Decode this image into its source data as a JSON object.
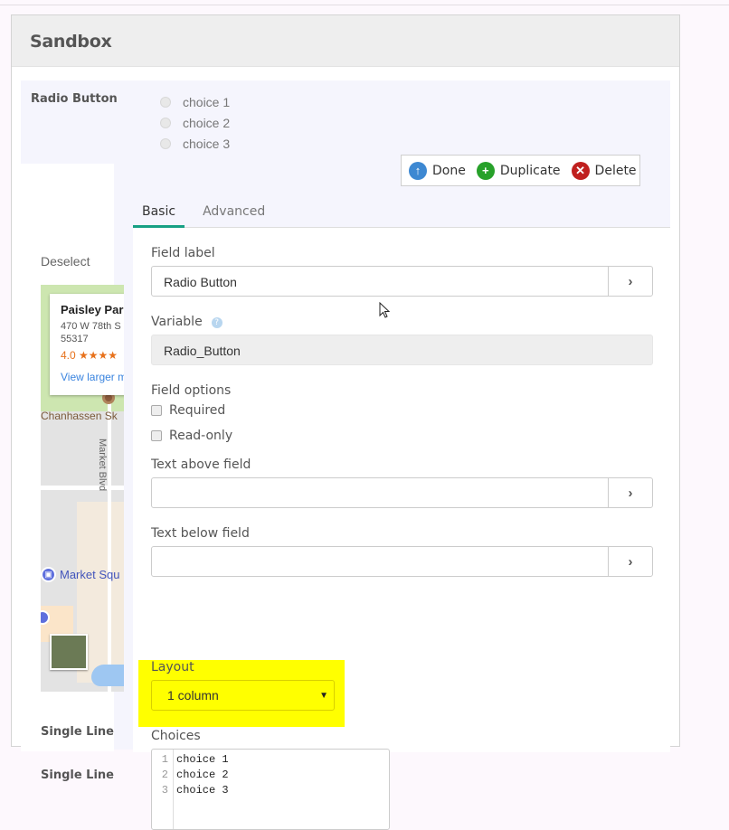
{
  "header": {
    "title": "Sandbox"
  },
  "field": {
    "label": "Radio Button",
    "choices": [
      "choice 1",
      "choice 2",
      "choice 3"
    ],
    "deselect": "Deselect"
  },
  "toolbar": {
    "done": "Done",
    "duplicate": "Duplicate",
    "delete": "Delete",
    "colors": {
      "done": "#3d88d2",
      "duplicate": "#27a12a",
      "delete": "#c0201f"
    }
  },
  "map": {
    "place_name": "Paisley Par",
    "address_line1": "470 W 78th S",
    "address_line2": "55317",
    "rating": "4.0 ★★★★",
    "view_larger": "View larger m",
    "label_chanhassen": "Chanhassen Sk",
    "label_market_blvd": "Market Blvd",
    "label_market_square": "Market Squ"
  },
  "other_fields": [
    "Single Line",
    "Single Line"
  ],
  "tabs": [
    {
      "label": "Basic",
      "active": true
    },
    {
      "label": "Advanced",
      "active": false
    }
  ],
  "form": {
    "field_label": {
      "label": "Field label",
      "value": "Radio Button"
    },
    "variable": {
      "label": "Variable",
      "value": "Radio_Button",
      "help": "?"
    },
    "field_options": {
      "label": "Field options",
      "required": "Required",
      "readonly": "Read-only"
    },
    "text_above": {
      "label": "Text above field",
      "value": ""
    },
    "text_below": {
      "label": "Text below field",
      "value": ""
    },
    "layout": {
      "label": "Layout",
      "value": "1 column",
      "highlight_color": "#ffff00"
    },
    "choices": {
      "label": "Choices",
      "line_numbers": [
        "1",
        "2",
        "3"
      ],
      "lines": [
        "choice 1",
        "choice 2",
        "choice 3"
      ]
    }
  },
  "accent_color": "#17a084"
}
